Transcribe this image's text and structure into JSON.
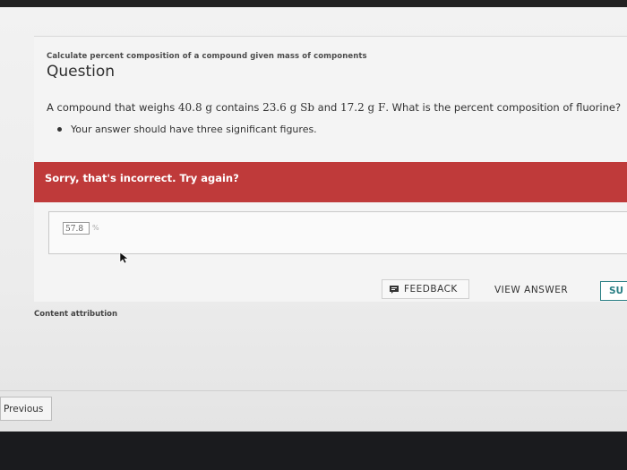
{
  "breadcrumb": "Calculate percent composition of a compound given mass of components",
  "question": {
    "heading": "Question",
    "text_prefix": "A compound that weighs ",
    "mass_total": "40.8 g",
    "text_mid1": " contains ",
    "mass_sb": "23.6 g Sb",
    "text_mid2": " and ",
    "mass_f": "17.2 g F",
    "text_suffix": ". What is the percent composition of fluorine?",
    "bullet": "Your answer should have three significant figures."
  },
  "feedback_banner": {
    "text": "Sorry, that's incorrect. Try again?",
    "color": "#bf3a3a"
  },
  "answer": {
    "value": "57.8",
    "unit": "%"
  },
  "actions": {
    "feedback_label": "FEEDBACK",
    "view_answer_label": "VIEW ANSWER",
    "submit_label": "SU"
  },
  "footer": {
    "content_attribution": "Content attribution",
    "previous_label": "Previous"
  },
  "colors": {
    "accent_teal": "#2a7f85",
    "error_red": "#bf3a3a"
  }
}
